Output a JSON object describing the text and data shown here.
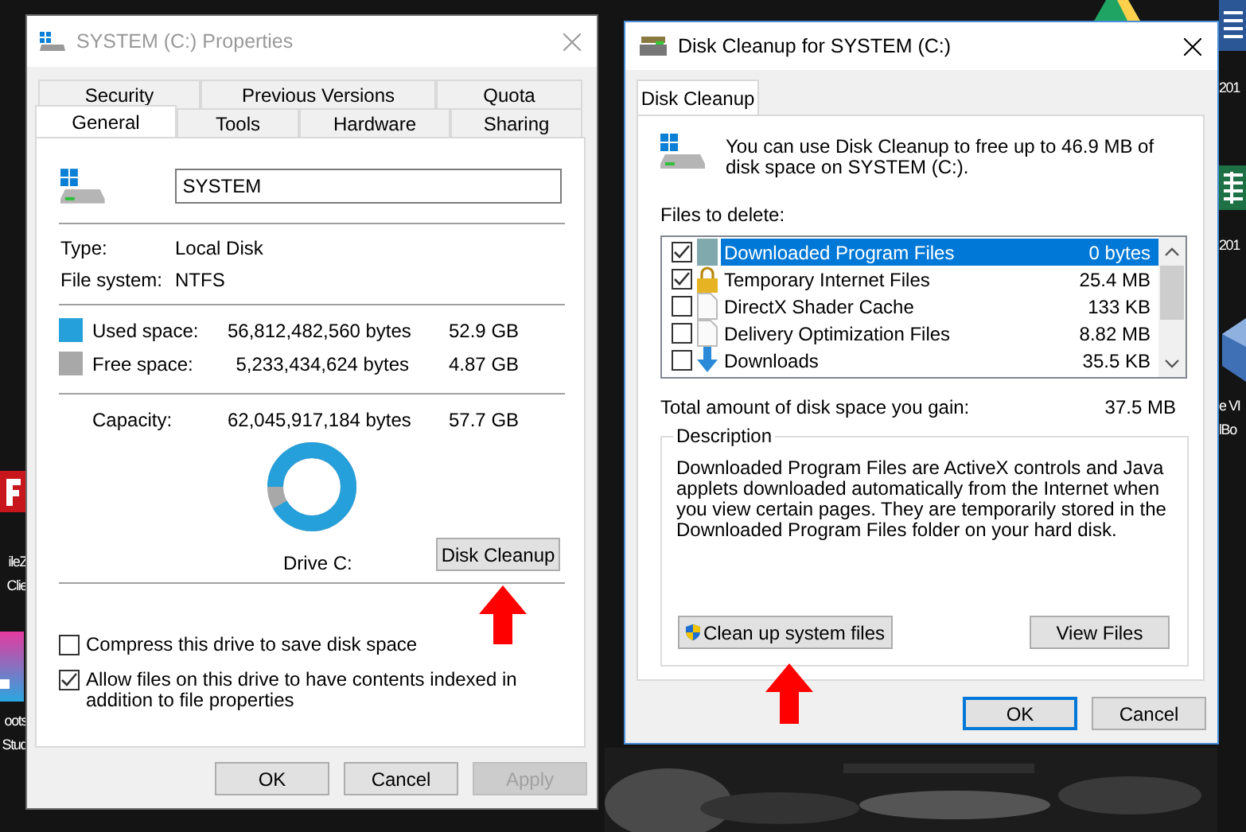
{
  "desktop": {
    "kind": "picture",
    "icons": [
      {
        "kind": "red-logo",
        "lines": [
          "ileZ",
          "Clie"
        ]
      },
      {
        "kind": "gradient-tile",
        "lines": [
          "oots",
          "Stud"
        ]
      },
      {
        "kind": "triangle-logo"
      },
      {
        "kind": "document",
        "lines": [
          "201"
        ]
      },
      {
        "kind": "spreadsheet",
        "lines": [
          "201"
        ]
      },
      {
        "kind": "cube",
        "lines": [
          "e VI",
          "lBo"
        ]
      }
    ]
  },
  "properties_window": {
    "title": "SYSTEM (C:) Properties",
    "active": false,
    "tab_rows": [
      [
        {
          "label": "Security",
          "selected": false
        },
        {
          "label": "Previous Versions",
          "selected": false
        },
        {
          "label": "Quota",
          "selected": false
        }
      ],
      [
        {
          "label": "General",
          "selected": true
        },
        {
          "label": "Tools",
          "selected": false
        },
        {
          "label": "Hardware",
          "selected": false
        },
        {
          "label": "Sharing",
          "selected": false
        }
      ]
    ],
    "name_field": {
      "value": "SYSTEM"
    },
    "info": [
      {
        "label": "Type:",
        "value": "Local Disk"
      },
      {
        "label": "File system:",
        "value": "NTFS"
      }
    ],
    "space": [
      {
        "label": "Used space:",
        "bytes": "56,812,482,560 bytes",
        "size": "52.9 GB",
        "color": "#26a0da"
      },
      {
        "label": "Free space:",
        "bytes": "5,233,434,624 bytes",
        "size": "4.87 GB",
        "color": "#a8a8a8"
      }
    ],
    "capacity": {
      "label": "Capacity:",
      "bytes": "62,045,917,184 bytes",
      "size": "57.7 GB"
    },
    "donut": {
      "level": 0.917
    },
    "drive_label": "Drive C:",
    "cleanup_button": "Disk Cleanup",
    "options": [
      {
        "label": "Compress this drive to save disk space",
        "checked": false
      },
      {
        "label": "Allow files on this drive to have contents indexed in addition to file properties",
        "checked": true
      }
    ],
    "buttons": [
      {
        "label": "OK",
        "disabled": false
      },
      {
        "label": "Cancel",
        "disabled": false
      },
      {
        "label": "Apply",
        "disabled": true
      }
    ]
  },
  "cleanup_window": {
    "title": "Disk Cleanup for SYSTEM (C:)",
    "active": true,
    "tabs": [
      {
        "label": "Disk Cleanup",
        "selected": true
      }
    ],
    "intro": "You can use Disk Cleanup to free up to 46.9 MB of disk space on SYSTEM (C:).",
    "files_label": "Files to delete:",
    "files": [
      {
        "kind": "tile",
        "name": "Downloaded Program Files",
        "size": "0 bytes",
        "checked": true,
        "selected": true
      },
      {
        "kind": "lock",
        "name": "Temporary Internet Files",
        "size": "25.4 MB",
        "checked": true,
        "selected": false
      },
      {
        "kind": "page",
        "name": "DirectX Shader Cache",
        "size": "133 KB",
        "checked": false,
        "selected": false
      },
      {
        "kind": "page",
        "name": "Delivery Optimization Files",
        "size": "8.82 MB",
        "checked": false,
        "selected": false
      },
      {
        "kind": "download",
        "name": "Downloads",
        "size": "35.5 KB",
        "checked": false,
        "selected": false
      }
    ],
    "total": {
      "label": "Total amount of disk space you gain:",
      "value": "37.5 MB"
    },
    "description": {
      "legend": "Description",
      "text": "Downloaded Program Files are ActiveX controls and Java applets downloaded automatically from the Internet when you view certain pages. They are temporarily stored in the Downloaded Program Files folder on your hard disk."
    },
    "group_buttons": [
      {
        "kind": "shield",
        "label": "Clean up system files"
      },
      {
        "kind": "plain",
        "label": "View Files"
      }
    ],
    "buttons": [
      {
        "label": "OK",
        "default": true
      },
      {
        "label": "Cancel",
        "default": false
      }
    ]
  }
}
